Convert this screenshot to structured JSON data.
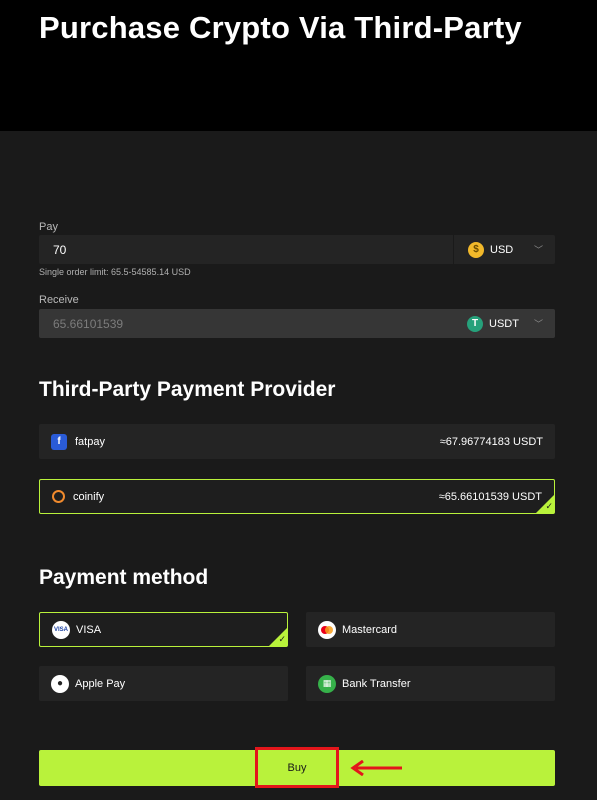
{
  "page": {
    "title": "Purchase Crypto Via Third-Party"
  },
  "pay": {
    "label": "Pay",
    "value": "70",
    "currency": "USD",
    "currency_icon": "$",
    "limit_hint": "Single order limit: 65.5-54585.14 USD"
  },
  "receive": {
    "label": "Receive",
    "value": "65.66101539",
    "currency": "USDT",
    "currency_icon": "T"
  },
  "providers": {
    "title": "Third-Party Payment Provider",
    "items": [
      {
        "name": "fatpay",
        "icon": "f",
        "amount": "≈67.96774183 USDT",
        "selected": false
      },
      {
        "name": "coinify",
        "icon": "",
        "amount": "≈65.66101539 USDT",
        "selected": true
      }
    ]
  },
  "payment": {
    "title": "Payment method",
    "methods": [
      {
        "name": "VISA",
        "icon": "VISA",
        "selected": true
      },
      {
        "name": "Mastercard",
        "icon": "",
        "selected": false
      },
      {
        "name": "Apple Pay",
        "icon": "",
        "selected": false
      },
      {
        "name": "Bank Transfer",
        "icon": "▦",
        "selected": false
      }
    ]
  },
  "actions": {
    "buy_label": "Buy"
  },
  "colors": {
    "accent": "#b9f23b",
    "annotation": "#e3161b",
    "hero_bg": "#000000",
    "page_bg": "#1a1a1a"
  }
}
